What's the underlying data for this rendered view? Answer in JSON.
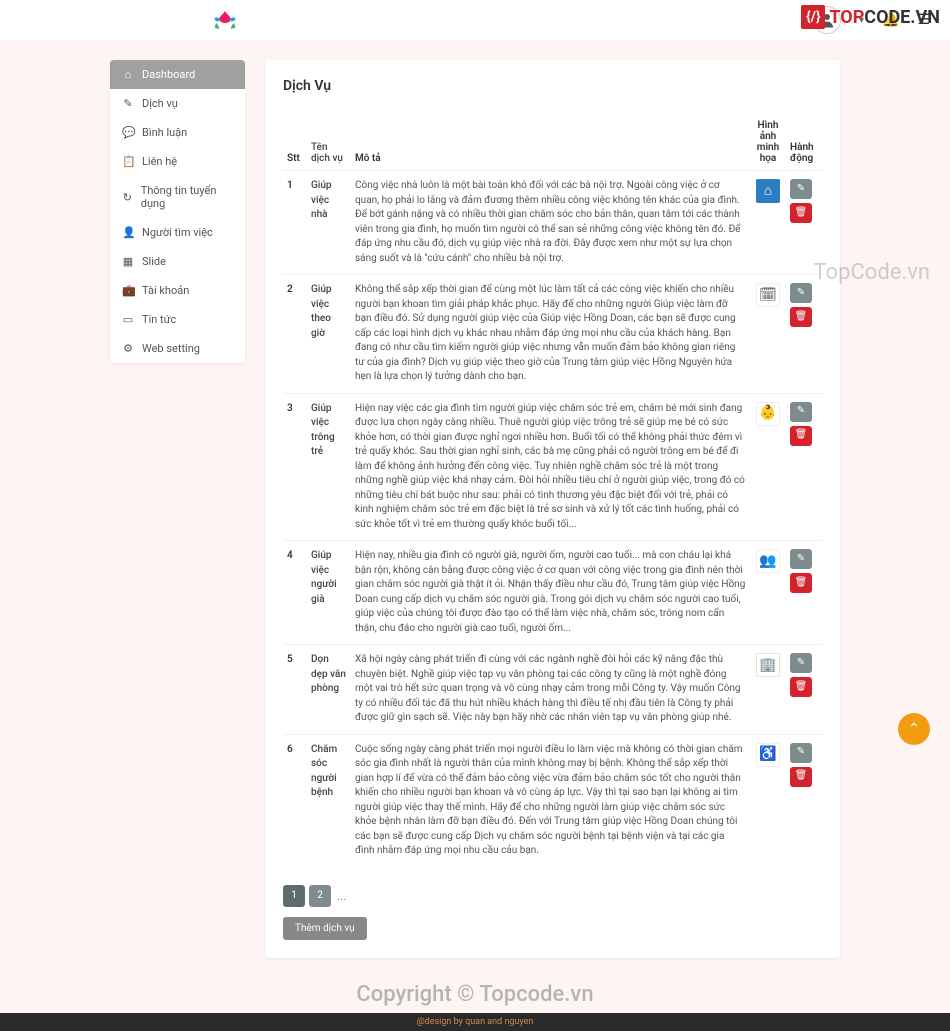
{
  "header": {
    "brand": "TOPCODE.VN",
    "brand_red": "TOP"
  },
  "sidebar": {
    "items": [
      {
        "icon": "⌂",
        "label": "Dashboard",
        "active": true
      },
      {
        "icon": "✎",
        "label": "Dịch vụ"
      },
      {
        "icon": "💬",
        "label": "Bình luận"
      },
      {
        "icon": "📋",
        "label": "Liên hệ"
      },
      {
        "icon": "↻",
        "label": "Thông tin tuyển dụng"
      },
      {
        "icon": "👤",
        "label": "Người tìm việc"
      },
      {
        "icon": "▦",
        "label": "Slide"
      },
      {
        "icon": "💼",
        "label": "Tài khoản"
      },
      {
        "icon": "▭",
        "label": "Tin tức"
      },
      {
        "icon": "⚙",
        "label": "Web setting"
      }
    ]
  },
  "main": {
    "title": "Dịch Vụ",
    "columns": {
      "stt": "Stt",
      "name": "Tên dịch vụ",
      "desc": "Mô tả",
      "img": "Hình ảnh minh họa",
      "act": "Hành động"
    },
    "rows": [
      {
        "stt": "1",
        "name": "Giúp việc nhà",
        "desc": "Công việc nhà luôn là một bài toán khó đối với các bà nội trợ. Ngoài công việc ở cơ quan, họ phải lo lắng và đảm đương thêm nhiều công việc không tên khác của gia đình. Để bớt gánh nặng và có nhiều thời gian chăm sóc cho bản thân, quan tâm tới các thành viên trong gia đình, họ muốn tìm người cô thể san sẻ những công việc không tên đó. Để đáp ứng nhu cầu đó, dịch vụ giúp việc nhà ra đời. Đây được xem như một sự lựa chọn sáng suốt và là \"cứu cánh\" cho nhiều bà nội trợ.",
        "thumb": "home",
        "thumbClass": "blue"
      },
      {
        "stt": "2",
        "name": "Giúp việc theo giờ",
        "desc": "Không thể sắp xếp thời gian để cùng một lúc làm tất cả các công việc khiến cho nhiều người bạn khoan tìm giải pháp khắc phục. Hãy để cho những người Giúp việc làm đỡ bạn điều đó. Sử dụng người giúp việc của Giúp việc Hồng Doan, các bạn sẽ được cung cấp các loại hình dịch vụ khác nhau nhằm đáp ứng mọi nhu cầu của khách hàng. Bạn đang có như cầu tìm kiếm người giúp việc nhưng vẫn muốn đảm bảo không gian riêng tư của gia đình? Dịch vụ giúp việc theo giờ của Trung tâm giúp việc Hồng Nguyên hứa hẹn là lựa chọn lý tưởng dành cho bạn.",
        "thumb": "clock",
        "thumbClass": "white"
      },
      {
        "stt": "3",
        "name": "Giúp việc trông trẻ",
        "desc": "Hiện nay việc các gia đình tìm người giúp việc chăm sóc trẻ em, chăm bé mới sinh đang được lựa chọn ngày càng nhiều. Thuê người giúp việc trông trẻ sẽ giúp mẹ bé có sức khỏe hơn, có thời gian được nghỉ ngơi nhiều hơn. Buổi tối có thể không phải thức đêm vì trẻ quấy khóc. Sau thời gian nghỉ sinh, các bà mẹ cũng phải có người trông em bé để đi làm để không ảnh hưởng đến công việc. Tuy nhiên nghề chăm sóc trẻ là một trong những nghề giúp việc khá nhạy cảm. Đòi hỏi nhiều tiêu chí ở người giúp việc, trong đó có những tiêu chí bát buộc như sau: phải có tình thương yêu đặc biệt đối với trẻ, phải có kinh nghiệm chăm sóc trẻ em đặc biệt là trẻ sơ sinh và xử lý tốt các tình huống, phải có sức khỏe tốt vì trẻ em thường quấy khóc buổi tối...",
        "thumb": "baby",
        "thumbClass": "white red-c"
      },
      {
        "stt": "4",
        "name": "Giúp việc người già",
        "desc": "Hiện nay, nhiều gia đình có người già, người ốm, người cao tuổi... mà con cháu lại khá bận rộn, không cân bằng được công việc ở cơ quan với công việc trong gia đình nên thời gian chăm sóc người già thật ít ỏi. Nhận thấy điều như cầu đó, Trung tâm giúp việc Hồng Doan cung cấp dịch vụ chăm sóc người già. Trong gói dịch vụ chăm sóc người cao tuổi, giúp việc của chúng tôi được đào tạo có thể làm việc nhà, chăm sóc, trông nom cẩn thận, chu đáo cho người già cao tuổi, người ốm...",
        "thumb": "people",
        "thumbClass": "white dblue"
      },
      {
        "stt": "5",
        "name": "Dọn dẹp văn phòng",
        "desc": "Xã hội ngày càng phát triển đi cùng với các ngành nghề đòi hỏi các kỹ năng đặc thù chuyên biệt. Nghề giúp việc tạp vụ văn phòng tại các công ty cũng là một nghề đóng một vai trò hết sức quan trọng và vô cùng nhạy cảm trong mỗi Công ty. Vậy muốn Công ty có nhiều đối tác đã thu hút nhiều khách hàng thì điều tế nhị đầu tiên là Công ty phải được giữ gìn sạch sẽ. Việc này bạn hãy nhờ các nhân viên tạp vụ văn phòng giúp nhé.",
        "thumb": "office",
        "thumbClass": "orange"
      },
      {
        "stt": "6",
        "name": "Chăm sóc người bệnh",
        "desc": "Cuộc sống ngày càng phát triển mọi người điều lo làm việc mà không có thời gian chăm sóc gia đình nhất là người thân của mình không may bị bệnh. Không thể sắp xếp thời gian hợp lí để vừa có thể đảm bảo công việc vừa đảm bảo chăm sóc tốt cho người thân khiến cho nhiều người bạn khoan và vô cùng áp lực. Vậy thì tại sao bạn lại không ai tìm người giúp việc thay thế mình. Hãy để cho những người làm giúp việc chăm sóc sức khỏe bệnh nhân làm đỡ bạn điều đó. Đến với Trung tâm giúp việc Hồng Doan chúng tôi các bạn sẽ được cung cấp Dịch vụ chăm sóc người bệnh tại bệnh viện và tại các gia đình nhằm đáp ứng mọi nhu cầu cảu bạn.",
        "thumb": "wheelchair",
        "thumbClass": "white pink"
      }
    ],
    "pagination": {
      "pages": [
        "1",
        "2"
      ],
      "dots": "..."
    },
    "add_label": "Thêm dịch vụ"
  },
  "watermarks": {
    "mid": "TopCode.vn",
    "bottom": "Copyright © Topcode.vn"
  },
  "footer": {
    "text": "@design by quan and nguyen"
  }
}
